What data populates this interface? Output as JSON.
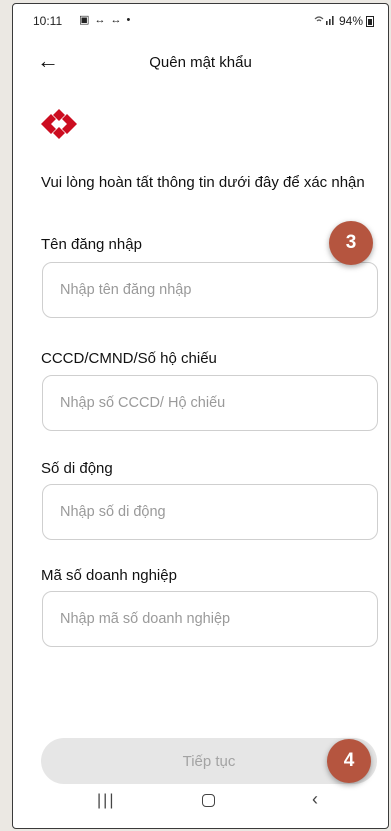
{
  "status_bar": {
    "time": "10:11",
    "left_icons": "▣ ↔ ↔ •",
    "signal": "◸.▎▐",
    "battery": "94%"
  },
  "header": {
    "back_icon": "←",
    "title": "Quên mật khẩu"
  },
  "logo": {
    "color": "#cc0d20"
  },
  "instruction": "Vui lòng hoàn tất thông tin dưới đây để xác nhận",
  "fields": [
    {
      "label": "Tên đăng nhập",
      "placeholder": "Nhập tên đăng nhập",
      "value": ""
    },
    {
      "label": "CCCD/CMND/Số hộ chiếu",
      "placeholder": "Nhập số CCCD/ Hộ chiếu",
      "value": ""
    },
    {
      "label": "Số di động",
      "placeholder": "Nhập số di động",
      "value": ""
    },
    {
      "label": "Mã số doanh nghiệp",
      "placeholder": "Nhập mã số doanh nghiệp",
      "value": ""
    }
  ],
  "badges": [
    "3",
    "4"
  ],
  "continue_label": "Tiếp tục",
  "nav": {
    "recent": "|||",
    "back": "‹"
  },
  "colors": {
    "badge": "#b5553f",
    "button_disabled": "#e6e6e6"
  }
}
